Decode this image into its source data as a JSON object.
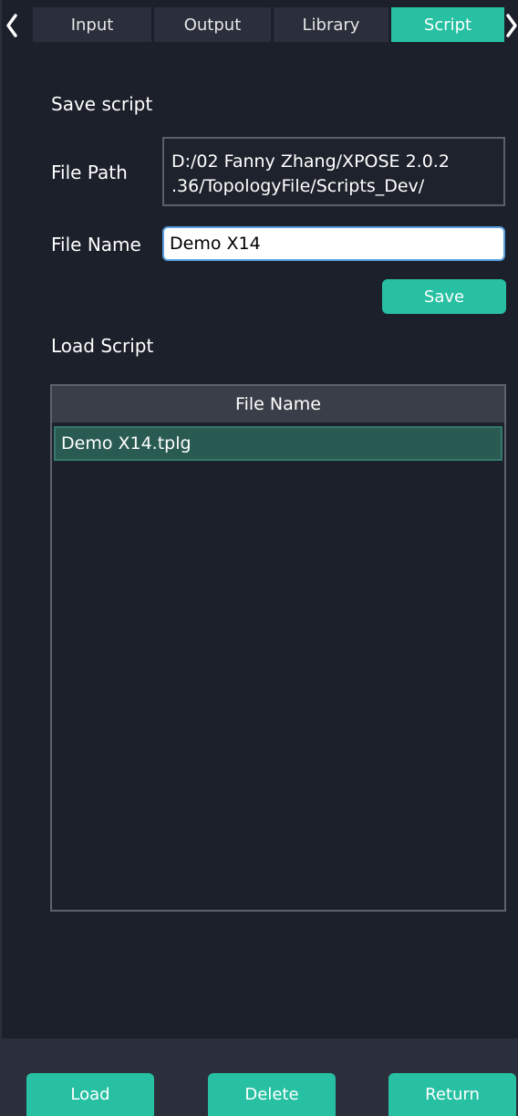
{
  "tabs": [
    {
      "label": "Input",
      "active": false
    },
    {
      "label": "Output",
      "active": false
    },
    {
      "label": "Library",
      "active": false
    },
    {
      "label": "Script",
      "active": true
    }
  ],
  "save_section": {
    "title": "Save script",
    "file_path_label": "File Path",
    "file_path_value": "D:/02 Fanny Zhang/XPOSE 2.0.2.36/TopologyFile/Scripts_Dev/",
    "file_path_line1": "D:/02 Fanny Zhang/XPOSE 2.0.2",
    "file_path_line2": ".36/TopologyFile/Scripts_Dev/",
    "file_name_label": "File Name",
    "file_name_value": "Demo X14",
    "save_label": "Save"
  },
  "load_section": {
    "title": "Load Script",
    "table_header": "File Name",
    "files": [
      "Demo X14.tplg"
    ]
  },
  "footer": {
    "load_label": "Load",
    "delete_label": "Delete",
    "return_label": "Return"
  },
  "colors": {
    "accent": "#27c0a2",
    "background": "#1c202b",
    "selected_row": "#2a5b52"
  },
  "icons": {
    "prev": "chevron-left-icon",
    "next": "chevron-right-icon"
  }
}
